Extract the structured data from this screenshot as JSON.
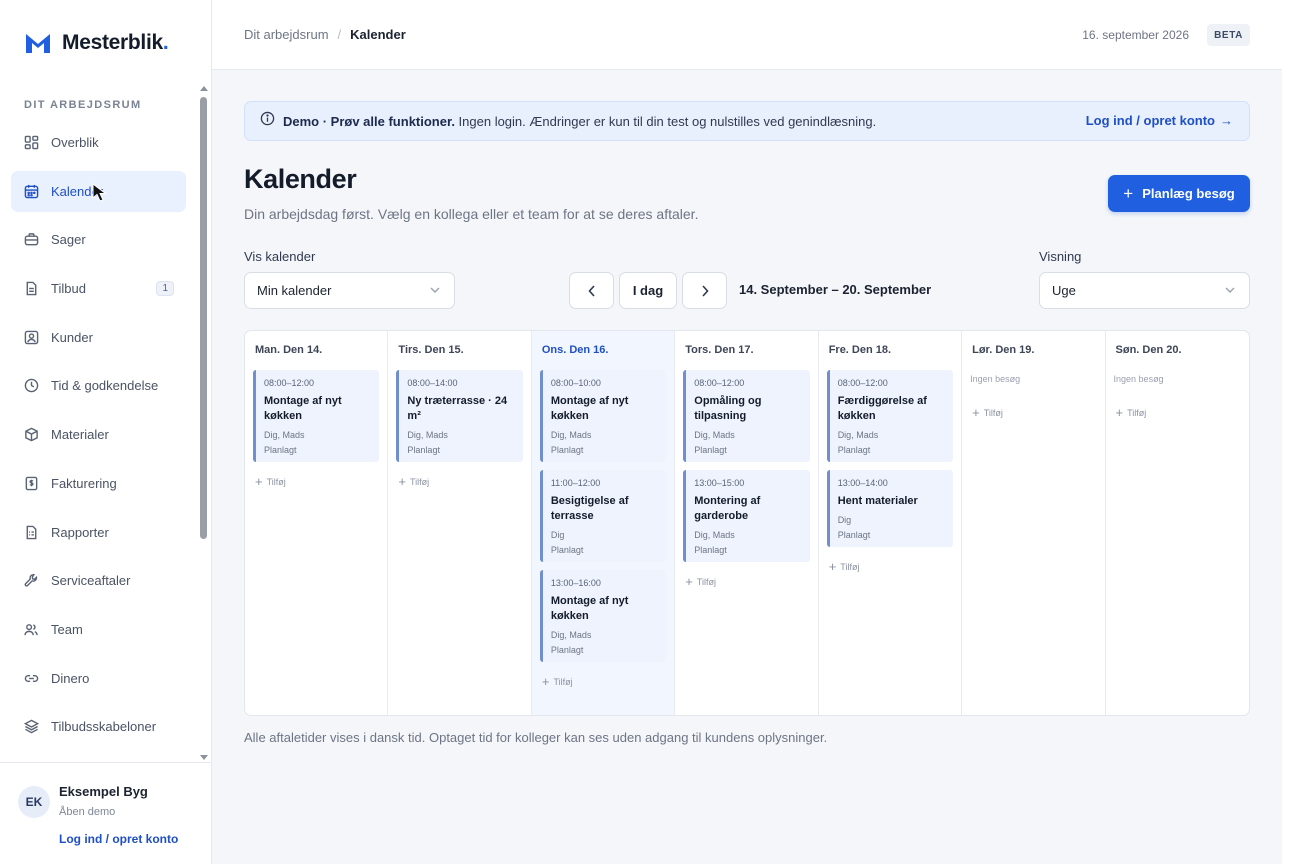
{
  "app": {
    "name": "Mesterblik",
    "name_dot": ".",
    "brand_color": "#1f5fe0"
  },
  "sidebar": {
    "section_title": "DIT ARBEJDSRUM",
    "items": [
      {
        "label": "Overblik",
        "icon": "grid-icon"
      },
      {
        "label": "Kalender",
        "icon": "calendar-icon",
        "active": true
      },
      {
        "label": "Sager",
        "icon": "briefcase-icon"
      },
      {
        "label": "Tilbud",
        "icon": "document-icon",
        "badge": "1"
      },
      {
        "label": "Kunder",
        "icon": "contact-icon"
      },
      {
        "label": "Tid & godkendelse",
        "icon": "clock-icon"
      },
      {
        "label": "Materialer",
        "icon": "box-icon"
      },
      {
        "label": "Fakturering",
        "icon": "invoice-icon"
      },
      {
        "label": "Rapporter",
        "icon": "report-icon"
      },
      {
        "label": "Serviceaftaler",
        "icon": "wrench-icon"
      },
      {
        "label": "Team",
        "icon": "users-icon"
      },
      {
        "label": "Dinero",
        "icon": "link-icon"
      },
      {
        "label": "Tilbudsskabeloner",
        "icon": "layers-icon"
      }
    ],
    "footer": {
      "avatar_initials": "EK",
      "company": "Eksempel Byg",
      "subtitle": "Åben demo",
      "login_link": "Log ind / opret konto"
    }
  },
  "header": {
    "breadcrumb_root": "Dit arbejdsrum",
    "breadcrumb_sep": "/",
    "breadcrumb_current": "Kalender",
    "date": "16. september 2026",
    "badge": "BETA"
  },
  "banner": {
    "bold": "Demo · Prøv alle funktioner.",
    "text": " Ingen login. Ændringer er kun til din test og nulstilles ved genindlæsning.",
    "link": "Log ind / opret konto",
    "link_arrow": "→"
  },
  "page": {
    "title": "Kalender",
    "subtitle": "Din arbejdsdag først. Vælg en kollega eller et team for at se deres aftaler.",
    "primary_button": "Planlæg besøg",
    "primary_button_icon": "+",
    "calendar_label": "Vis kalender",
    "calendar_value": "Min kalender",
    "prev_icon": "‹",
    "today_button": "I dag",
    "next_icon": "›",
    "range": "14. September – 20. September",
    "view_label": "Visning",
    "view_value": "Uge",
    "footnote": "Alle aftaletider vises i dansk tid. Optaget tid for kolleger kan ses uden adgang til kundens oplysninger."
  },
  "calendar": {
    "add_label": "Tilføj",
    "add_icon": "+",
    "none_label": "Ingen besøg",
    "days": [
      {
        "label": "Man. Den 14.",
        "today": false,
        "events": [
          {
            "time": "08:00–12:00",
            "title": "Montage af nyt køkken",
            "who": "Dig, Mads",
            "status": "Planlagt"
          }
        ]
      },
      {
        "label": "Tirs. Den 15.",
        "today": false,
        "events": [
          {
            "time": "08:00–14:00",
            "title": "Ny træterrasse · 24 m²",
            "who": "Dig, Mads",
            "status": "Planlagt"
          }
        ]
      },
      {
        "label": "Ons. Den 16.",
        "today": true,
        "events": [
          {
            "time": "08:00–10:00",
            "title": "Montage af nyt køkken",
            "who": "Dig, Mads",
            "status": "Planlagt"
          },
          {
            "time": "11:00–12:00",
            "title": "Besigtigelse af terrasse",
            "who": "Dig",
            "status": "Planlagt"
          },
          {
            "time": "13:00–16:00",
            "title": "Montage af nyt køkken",
            "who": "Dig, Mads",
            "status": "Planlagt"
          }
        ]
      },
      {
        "label": "Tors. Den 17.",
        "today": false,
        "events": [
          {
            "time": "08:00–12:00",
            "title": "Opmåling og tilpasning",
            "who": "Dig, Mads",
            "status": "Planlagt"
          },
          {
            "time": "13:00–15:00",
            "title": "Montering af garderobe",
            "who": "Dig, Mads",
            "status": "Planlagt"
          }
        ]
      },
      {
        "label": "Fre. Den 18.",
        "today": false,
        "events": [
          {
            "time": "08:00–12:00",
            "title": "Færdiggørelse af køkken",
            "who": "Dig, Mads",
            "status": "Planlagt"
          },
          {
            "time": "13:00–14:00",
            "title": "Hent materialer",
            "who": "Dig",
            "status": "Planlagt"
          }
        ]
      },
      {
        "label": "Lør. Den 19.",
        "today": false,
        "events": []
      },
      {
        "label": "Søn. Den 20.",
        "today": false,
        "events": []
      }
    ]
  }
}
